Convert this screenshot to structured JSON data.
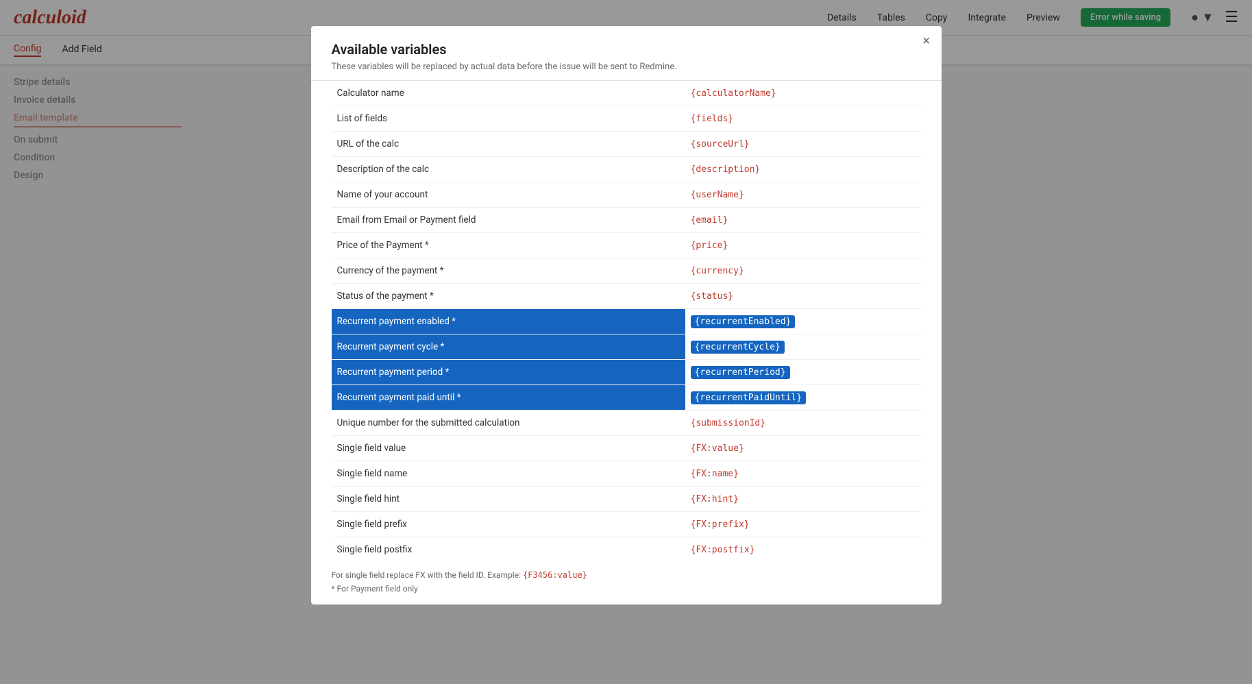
{
  "app": {
    "logo": "calculoid",
    "nav": {
      "links": [
        "Details",
        "Tables",
        "Copy",
        "Integrate",
        "Preview"
      ],
      "error_badge": "Error while saving"
    },
    "sub_nav": {
      "items": [
        "Config",
        "Add Field"
      ],
      "active": "Config"
    }
  },
  "sidebar": {
    "sections": [
      "Stripe details",
      "Invoice details",
      "Email template",
      "On submit",
      "Condition",
      "Design"
    ],
    "active_section": "Email template"
  },
  "modal": {
    "title": "Available variables",
    "subtitle": "These variables will be replaced by actual data before the issue will be sent to Redmine.",
    "close_label": "×",
    "variables": [
      {
        "label": "Calculator name",
        "code": "{calculatorName}",
        "highlighted": false
      },
      {
        "label": "List of fields",
        "code": "{fields}",
        "highlighted": false
      },
      {
        "label": "URL of the calc",
        "code": "{sourceUrl}",
        "highlighted": false
      },
      {
        "label": "Description of the calc",
        "code": "{description}",
        "highlighted": false
      },
      {
        "label": "Name of your account",
        "code": "{userName}",
        "highlighted": false
      },
      {
        "label": "Email from Email or Payment field",
        "code": "{email}",
        "highlighted": false
      },
      {
        "label": "Price of the Payment *",
        "code": "{price}",
        "highlighted": false
      },
      {
        "label": "Currency of the payment *",
        "code": "{currency}",
        "highlighted": false
      },
      {
        "label": "Status of the payment *",
        "code": "{status}",
        "highlighted": false
      },
      {
        "label": "Recurrent payment enabled *",
        "code": "{recurrentEnabled}",
        "highlighted": true
      },
      {
        "label": "Recurrent payment cycle *",
        "code": "{recurrentCycle}",
        "highlighted": true
      },
      {
        "label": "Recurrent payment period *",
        "code": "{recurrentPeriod}",
        "highlighted": true
      },
      {
        "label": "Recurrent payment paid until *",
        "code": "{recurrentPaidUntil}",
        "highlighted": true
      },
      {
        "label": "Unique number for the submitted calculation",
        "code": "{submissionId}",
        "highlighted": false
      },
      {
        "label": "Single field value",
        "code": "{FX:value}",
        "highlighted": false
      },
      {
        "label": "Single field name",
        "code": "{FX:name}",
        "highlighted": false
      },
      {
        "label": "Single field hint",
        "code": "{FX:hint}",
        "highlighted": false
      },
      {
        "label": "Single field prefix",
        "code": "{FX:prefix}",
        "highlighted": false
      },
      {
        "label": "Single field postfix",
        "code": "{FX:postfix}",
        "highlighted": false
      }
    ],
    "footer_note": "For single field replace FX with the field ID. Example:",
    "footer_example": "{F3456:value}",
    "footer_asterisk": "* For Payment field only"
  }
}
